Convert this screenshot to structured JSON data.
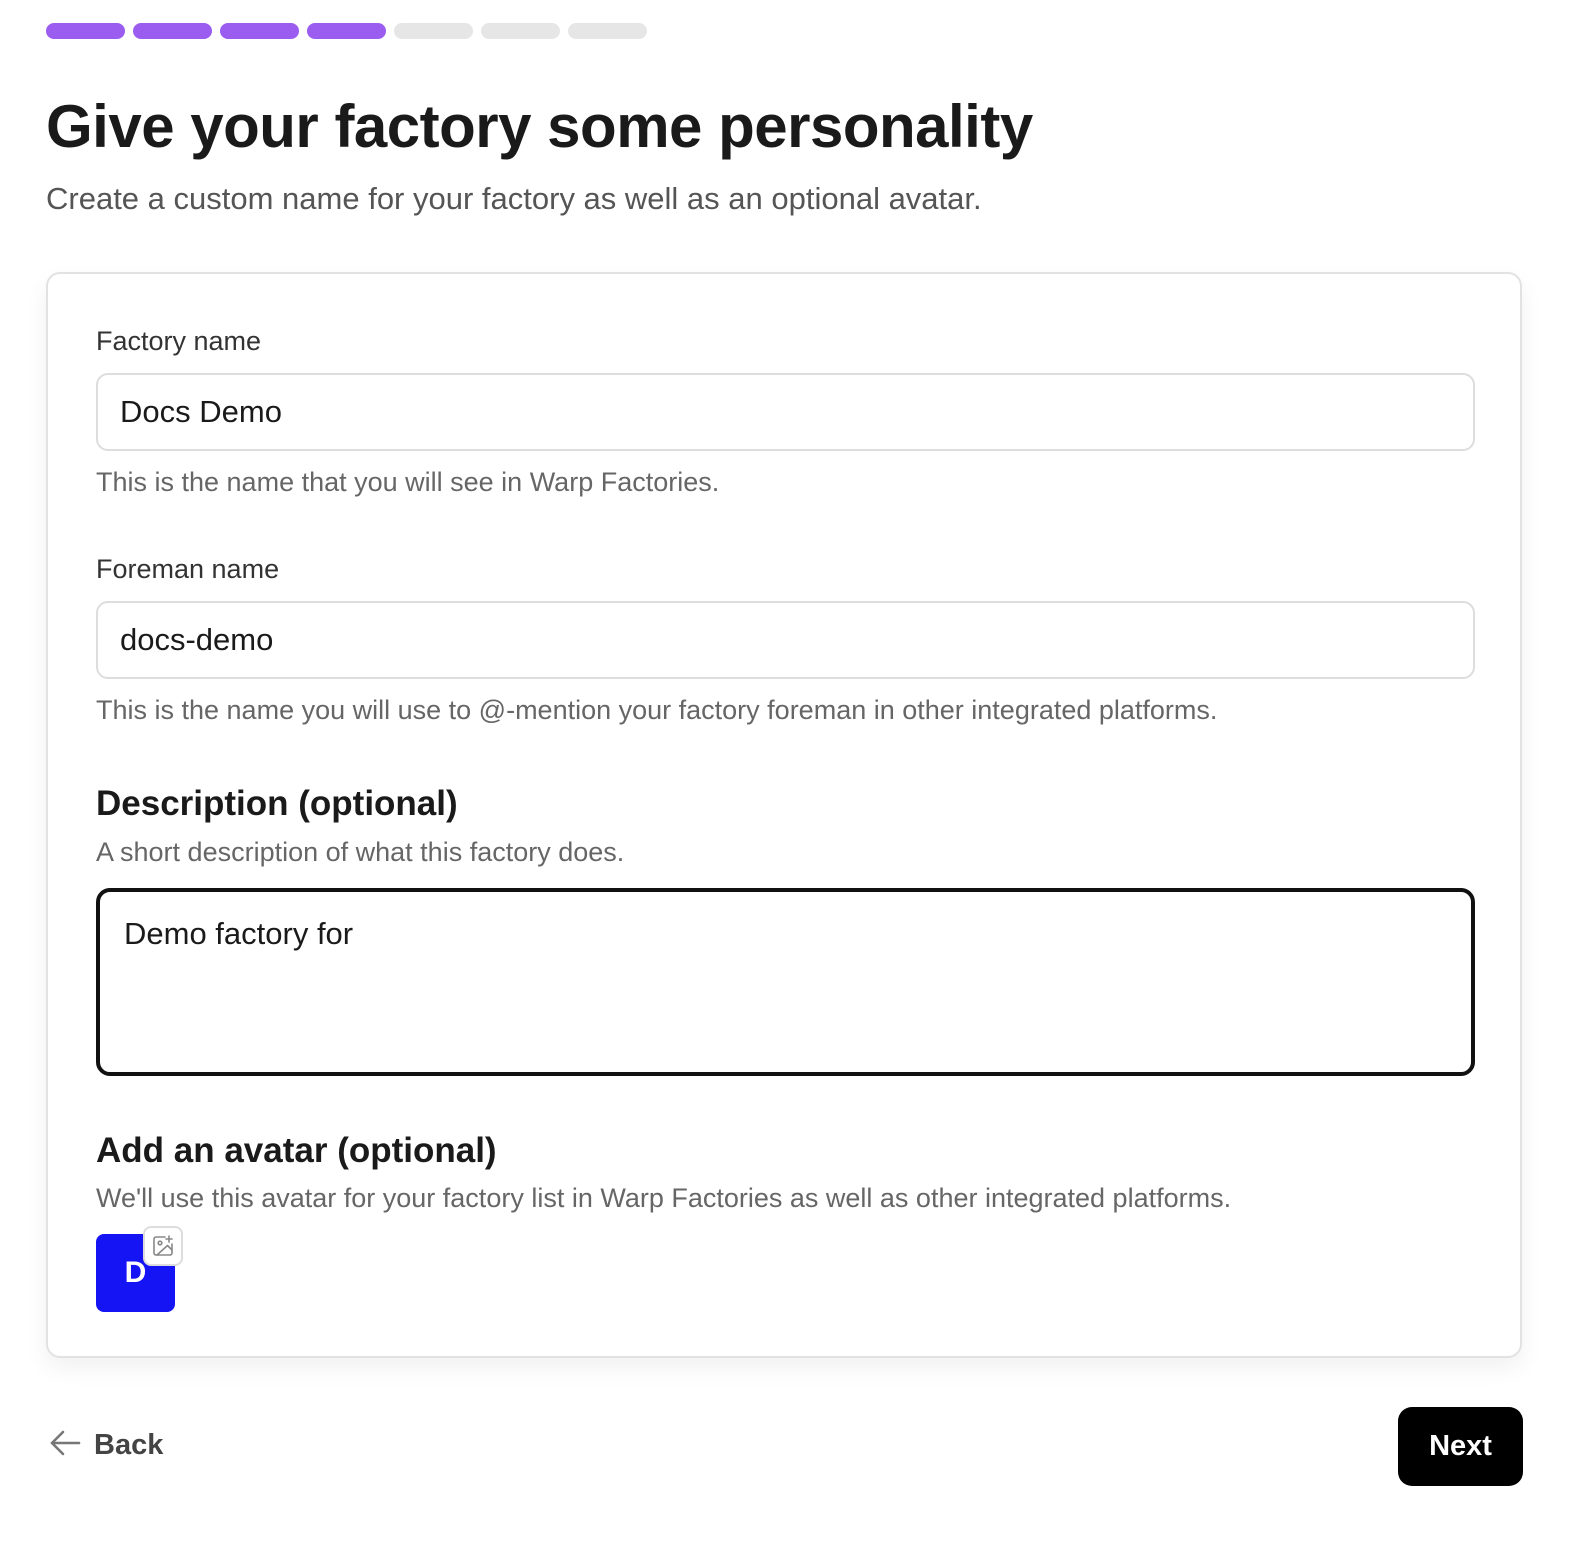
{
  "progress": {
    "total_steps": 7,
    "completed_steps": 4,
    "active_color": "#9b5cf0",
    "inactive_color": "#e6e6e6"
  },
  "header": {
    "title": "Give your factory some personality",
    "subtitle": "Create a custom name for your factory as well as an optional avatar."
  },
  "form": {
    "factory_name": {
      "label": "Factory name",
      "value": "Docs Demo",
      "helper": "This is the name that you will see in Warp Factories."
    },
    "foreman_name": {
      "label": "Foreman name",
      "value": "docs-demo",
      "helper": "This is the name you will use to @-mention your factory foreman in other integrated platforms."
    },
    "description": {
      "title": "Description (optional)",
      "helper": "A short description of what this factory does.",
      "value": "Demo factory for"
    },
    "avatar": {
      "title": "Add an avatar (optional)",
      "helper": "We'll use this avatar for your factory list in Warp Factories as well as other integrated platforms.",
      "initial": "D",
      "color": "#1414f5",
      "edit_icon": "image-add-icon"
    }
  },
  "footer": {
    "back_label": "Back",
    "back_icon": "arrow-left-icon",
    "next_label": "Next"
  }
}
